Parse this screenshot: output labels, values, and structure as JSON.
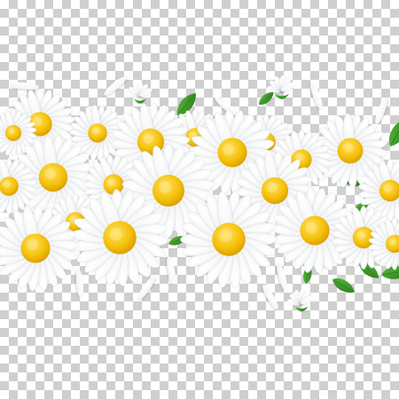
{
  "image": {
    "subject": "daisy-border",
    "background": "transparency-checkerboard",
    "colors": {
      "checker_dark": "#cfcfcf",
      "checker_light": "#ffffff",
      "petal": "#ffffff",
      "petal_shadow": "#d9dde0",
      "center": "#f2b705",
      "center_highlight": "#ffd84a",
      "leaf": "#3f9b2e",
      "leaf_dark": "#2c7a1f"
    },
    "flower_count": 22,
    "bud_count": 4,
    "loose_petal_count": 12
  }
}
